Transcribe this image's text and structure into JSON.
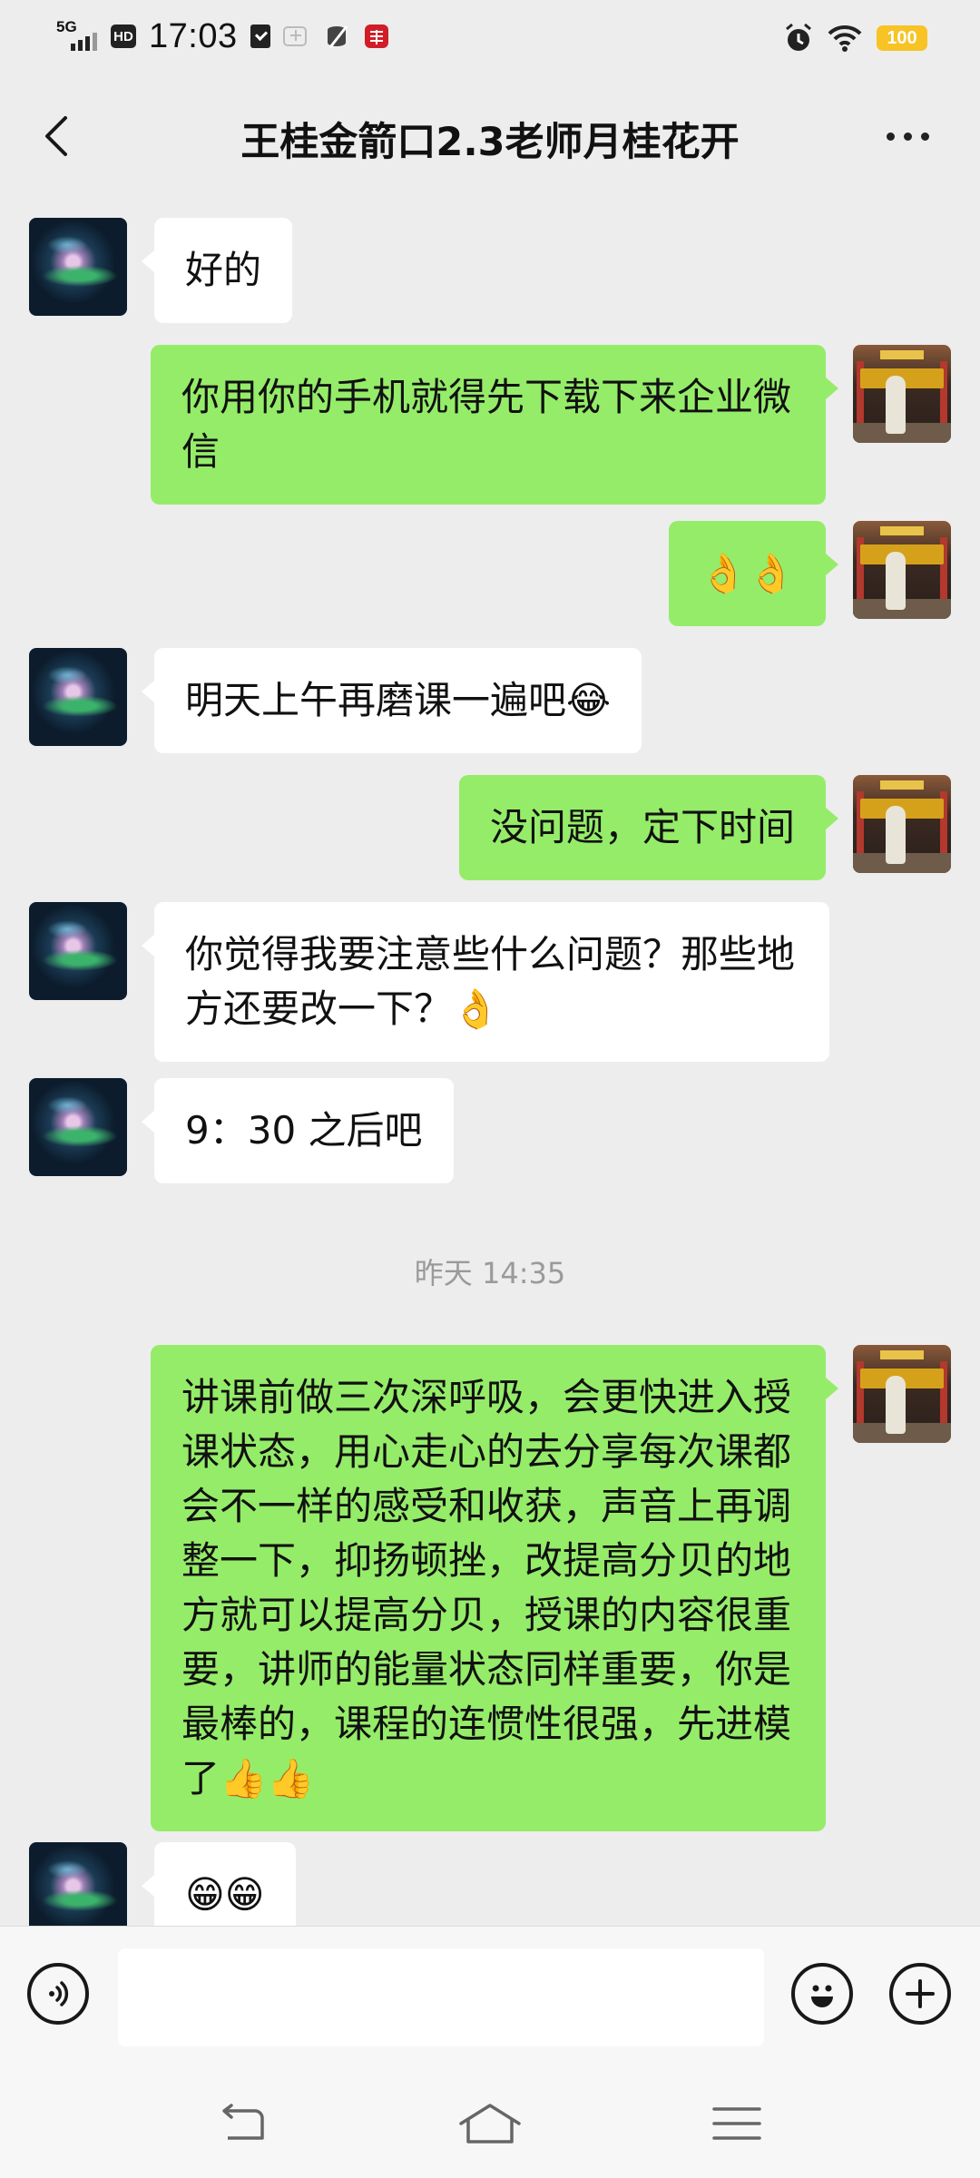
{
  "status_bar": {
    "network": "5G",
    "hd": "HD",
    "time": "17:03",
    "battery": "100",
    "icons": [
      "signal-icon",
      "hd-icon",
      "checklist-icon",
      "app-icon",
      "app-red-icon",
      "alarm-icon",
      "wifi-icon",
      "battery-icon"
    ]
  },
  "header": {
    "title": "王桂金箭口2.3老师月桂花开",
    "back_icon": "chevron-left-icon",
    "more_icon": "more-dots-icon"
  },
  "messages": [
    {
      "side": "in",
      "text": "好的"
    },
    {
      "side": "out",
      "text": "你用你的手机就得先下载下来企业微信"
    },
    {
      "side": "out",
      "text": "👌👌"
    },
    {
      "side": "in",
      "text": "明天上午再磨课一遍吧😂"
    },
    {
      "side": "out",
      "text": "没问题，定下时间"
    },
    {
      "side": "in",
      "text": "你觉得我要注意些什么问题？那些地方还要改一下？👌"
    },
    {
      "side": "in",
      "text": "9：30 之后吧"
    },
    {
      "type": "time",
      "text": "昨天 14:35"
    },
    {
      "side": "out",
      "text": "讲课前做三次深呼吸，会更快进入授课状态，用心走心的去分享每次课都会不一样的感受和收获，声音上再调整一下，抑扬顿挫，改提高分贝的地方就可以提高分贝，授课的内容很重要，讲师的能量状态同样重要，你是最棒的，课程的连惯性很强，先进模了👍👍"
    },
    {
      "side": "in",
      "text": "😁😁"
    }
  ],
  "input_bar": {
    "voice_icon": "voice-icon",
    "emoji_icon": "emoji-icon",
    "plus_icon": "plus-icon",
    "value": ""
  },
  "nav_bar": {
    "icons": [
      "back-nav-icon",
      "home-icon",
      "menu-icon"
    ]
  },
  "colors": {
    "background": "#ededed",
    "outgoing_bubble": "#95ec69",
    "incoming_bubble": "#ffffff",
    "battery": "#f7c325"
  }
}
